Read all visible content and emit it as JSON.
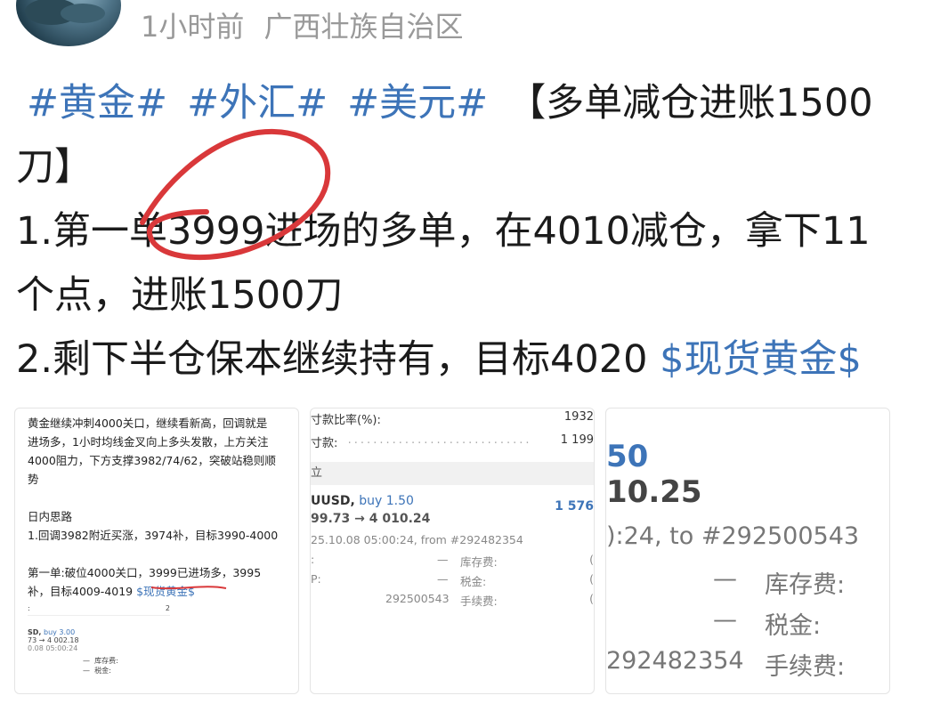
{
  "header": {
    "time": "1小时前",
    "location": "广西壮族自治区"
  },
  "post": {
    "tags": [
      "#黄金#",
      "#外汇#",
      "#美元#"
    ],
    "title_a": "【多单减仓进账1500",
    "title_b": "刀】",
    "line1a": "1.第一单3999进场的多单，在4010减仓，拿下11",
    "line1b": "个点，进账1500刀",
    "line2": "2.剩下半仓保本继续持有，目标4020 ",
    "stock_tag": "$现货黄金$"
  },
  "card1": {
    "p1": [
      "黄金继续冲刺4000关口，继续看新高，回调就是",
      "进场多，1小时均线金叉向上多头发散，上方关注",
      "4000阻力，下方支撑3982/74/62，突破站稳则顺",
      "势"
    ],
    "p2": [
      "日内思路",
      "1.回调3982附近买涨，3974补，目标3990-4000"
    ],
    "p3a": "第一单:破位4000关口，3999已进场多，3995",
    "p3b": "补，目标4009-4019 ",
    "p3_link": "$现货黄金$",
    "mini": {
      "row1_left": ":",
      "row1_right": "2",
      "symbol": "SD,",
      "side": "buy 3.00",
      "prices": "73 → 4 002.18",
      "time": "0.08 05:00:24",
      "swap_label": "库存费:",
      "tax_label": "税金:",
      "dash": "—"
    }
  },
  "card2": {
    "row1_label": "寸款比率(%):",
    "row1_value": "1932",
    "row2_label": "寸款:",
    "row2_value": "1 199",
    "section": "立",
    "symbol": "UUSD,",
    "side": "buy 1.50",
    "profit": "1 576",
    "prices": "99.73 → 4 010.24",
    "info": "25.10.08 05:00:24, from #292482354",
    "r1_left": ":",
    "r2_left": "P:",
    "dash": "—",
    "swap_label": "库存费:",
    "tax_label": "税金:",
    "fee_label": "手续费:",
    "ticket": "292500543",
    "zero": "("
  },
  "card3": {
    "big1": "50",
    "big2": "10.25",
    "info": "):24, to #292500543",
    "dash": "—",
    "swap_label": "库存费:",
    "tax_label": "税金:",
    "ticket": "292482354",
    "fee_label": "手续费:"
  },
  "colors": {
    "link": "#3d74b8",
    "circle": "#d9383a",
    "meta": "#999999"
  }
}
